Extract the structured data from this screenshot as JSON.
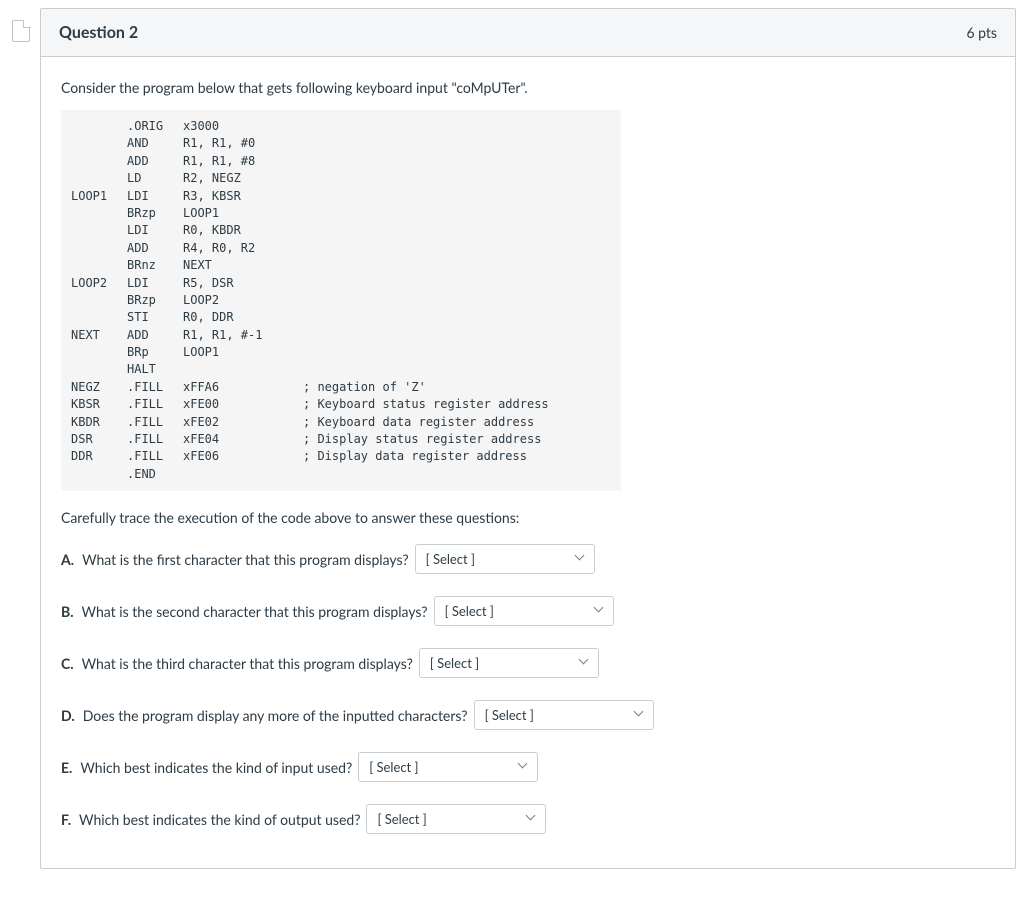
{
  "header": {
    "title": "Question 2",
    "points": "6 pts"
  },
  "intro": "Consider the program below that gets following keyboard input \"coMpUTer\".",
  "code": [
    {
      "label": "",
      "op": ".ORIG",
      "arg": "x3000",
      "cmt": ""
    },
    {
      "label": "",
      "op": "AND",
      "arg": "R1, R1, #0",
      "cmt": ""
    },
    {
      "label": "",
      "op": "ADD",
      "arg": "R1, R1, #8",
      "cmt": ""
    },
    {
      "label": "",
      "op": "LD",
      "arg": "R2, NEGZ",
      "cmt": ""
    },
    {
      "label": "LOOP1",
      "op": "LDI",
      "arg": "R3, KBSR",
      "cmt": ""
    },
    {
      "label": "",
      "op": "BRzp",
      "arg": "LOOP1",
      "cmt": ""
    },
    {
      "label": "",
      "op": "LDI",
      "arg": "R0, KBDR",
      "cmt": ""
    },
    {
      "label": "",
      "op": "ADD",
      "arg": "R4, R0, R2",
      "cmt": ""
    },
    {
      "label": "",
      "op": "BRnz",
      "arg": "NEXT",
      "cmt": ""
    },
    {
      "label": "LOOP2",
      "op": "LDI",
      "arg": "R5, DSR",
      "cmt": ""
    },
    {
      "label": "",
      "op": "BRzp",
      "arg": "LOOP2",
      "cmt": ""
    },
    {
      "label": "",
      "op": "STI",
      "arg": "R0, DDR",
      "cmt": ""
    },
    {
      "label": "NEXT",
      "op": "ADD",
      "arg": "R1, R1, #-1",
      "cmt": ""
    },
    {
      "label": "",
      "op": "BRp",
      "arg": "LOOP1",
      "cmt": ""
    },
    {
      "label": "",
      "op": "HALT",
      "arg": "",
      "cmt": ""
    },
    {
      "label": "NEGZ",
      "op": ".FILL",
      "arg": "xFFA6",
      "cmt": "; negation of 'Z'"
    },
    {
      "label": "KBSR",
      "op": ".FILL",
      "arg": "xFE00",
      "cmt": "; Keyboard status register address"
    },
    {
      "label": "KBDR",
      "op": ".FILL",
      "arg": "xFE02",
      "cmt": "; Keyboard data register address"
    },
    {
      "label": "DSR",
      "op": ".FILL",
      "arg": "xFE04",
      "cmt": "; Display status register address"
    },
    {
      "label": "DDR",
      "op": ".FILL",
      "arg": "xFE06",
      "cmt": "; Display data register address"
    },
    {
      "label": "",
      "op": ".END",
      "arg": "",
      "cmt": ""
    }
  ],
  "trace_intro": "Carefully trace the execution of the code above to answer these questions:",
  "questions": {
    "a": {
      "label": "A.",
      "text": "What is the first character that this program displays?",
      "select": "[ Select ]"
    },
    "b": {
      "label": "B.",
      "text": "What is the second character that this program displays?",
      "select": "[ Select ]"
    },
    "c": {
      "label": "C.",
      "text": "What is the third character that this program displays?",
      "select": "[ Select ]"
    },
    "d": {
      "label": "D.",
      "text": "Does the program display any more of the inputted characters?",
      "select": "[ Select ]"
    },
    "e": {
      "label": "E.",
      "text": "Which best indicates the kind of input used?",
      "select": "[ Select ]"
    },
    "f": {
      "label": "F.",
      "text": "Which best indicates the kind of output used?",
      "select": "[ Select ]"
    }
  }
}
